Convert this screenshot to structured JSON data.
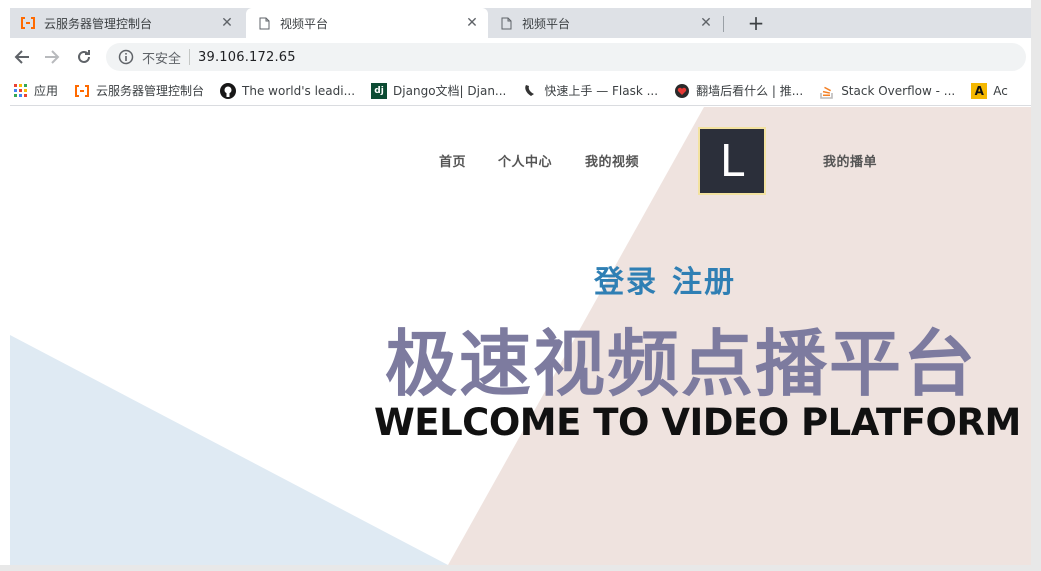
{
  "browser": {
    "tabs": [
      {
        "title": "云服务器管理控制台",
        "favicon": "aliyun-icon"
      },
      {
        "title": "视频平台",
        "favicon": "page-icon"
      },
      {
        "title": "视频平台",
        "favicon": "page-icon"
      }
    ],
    "new_tab": "+",
    "close_glyph": "✕",
    "omnibox": {
      "security_label": "不安全",
      "url": "39.106.172.65"
    },
    "bookmarks": [
      {
        "label": "应用",
        "icon": "apps-grid-icon"
      },
      {
        "label": "云服务器管理控制台",
        "icon": "aliyun-icon"
      },
      {
        "label": "The world's leadi...",
        "icon": "github-icon"
      },
      {
        "label": "Django文档| Djan...",
        "icon": "django-icon"
      },
      {
        "label": "快速上手 — Flask ...",
        "icon": "flask-icon"
      },
      {
        "label": "翻墙后看什么 | 推...",
        "icon": "heart-icon"
      },
      {
        "label": "Stack Overflow - ...",
        "icon": "stackoverflow-icon"
      },
      {
        "label": "Ac",
        "icon": "a-icon"
      }
    ]
  },
  "site": {
    "nav": {
      "home": "首页",
      "profile": "个人中心",
      "my_videos": "我的视频",
      "my_playlist": "我的播单"
    },
    "logo_letter": "L",
    "auth": {
      "login": "登录",
      "register": "注册"
    },
    "headline": "极速视频点播平台",
    "subheadline": "WELCOME TO VIDEO PLATFORM"
  },
  "colors": {
    "accent_blue": "#2f7fb4",
    "headline_purple": "#7d7b9f",
    "bg_pink": "#efe3df",
    "bg_blue": "#dfeaf3",
    "logo_bg": "#2b2f3a"
  }
}
